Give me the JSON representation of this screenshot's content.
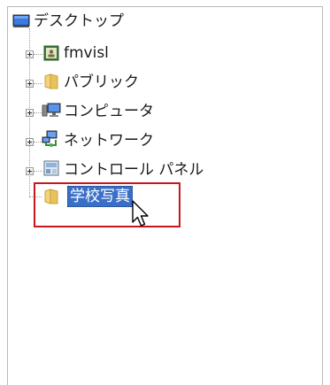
{
  "tree": {
    "root": {
      "label": "デスクトップ",
      "icon": "desktop-icon"
    },
    "items": [
      {
        "label": "fmvisl",
        "icon": "user-folder-icon",
        "expandable": true
      },
      {
        "label": "パブリック",
        "icon": "folder-icon",
        "expandable": true
      },
      {
        "label": "コンピュータ",
        "icon": "computer-icon",
        "expandable": true
      },
      {
        "label": "ネットワーク",
        "icon": "network-icon",
        "expandable": true
      },
      {
        "label": "コントロール パネル",
        "icon": "control-panel-icon",
        "expandable": true
      },
      {
        "label": "学校写真",
        "icon": "folder-icon",
        "expandable": false,
        "selected": true
      }
    ]
  },
  "colors": {
    "selection": "#3a6fc8",
    "annotation_box": "#c8161d",
    "folder": "#e8c35a"
  }
}
